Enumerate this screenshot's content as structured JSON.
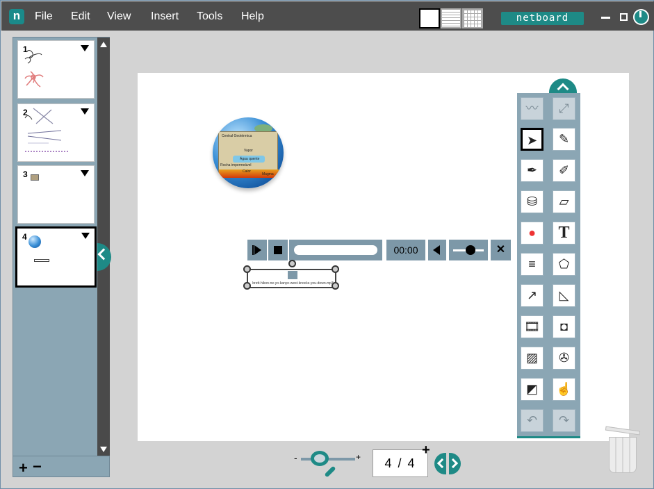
{
  "menubar": {
    "logo": "n",
    "items": [
      "File",
      "Edit",
      "View",
      "Insert",
      "Tools",
      "Help"
    ],
    "brand": "netboard"
  },
  "sidebar": {
    "pages": [
      {
        "number": "1"
      },
      {
        "number": "2"
      },
      {
        "number": "3"
      },
      {
        "number": "4"
      }
    ],
    "add_label": "+",
    "remove_label": "−"
  },
  "canvas": {
    "globe_labels": {
      "central": "Central Geotérmica",
      "vapor": "Vapor",
      "agua": "Água quente",
      "rocha": "Rocha impermeável",
      "calor": "Calor",
      "magma": "Magma"
    },
    "player": {
      "time": "00:00",
      "close": "✕"
    },
    "audio_filename": "brett-hikon-ne-yo-kanye-west-knocks-you-down.mp3"
  },
  "footer": {
    "zoom_minus": "-",
    "zoom_plus": "+",
    "page_indicator": "4 / 4",
    "page_add": "+"
  },
  "colors": {
    "accent": "#1e8a86",
    "menubar": "#4d4d4d",
    "panel": "#8ba6b4"
  }
}
